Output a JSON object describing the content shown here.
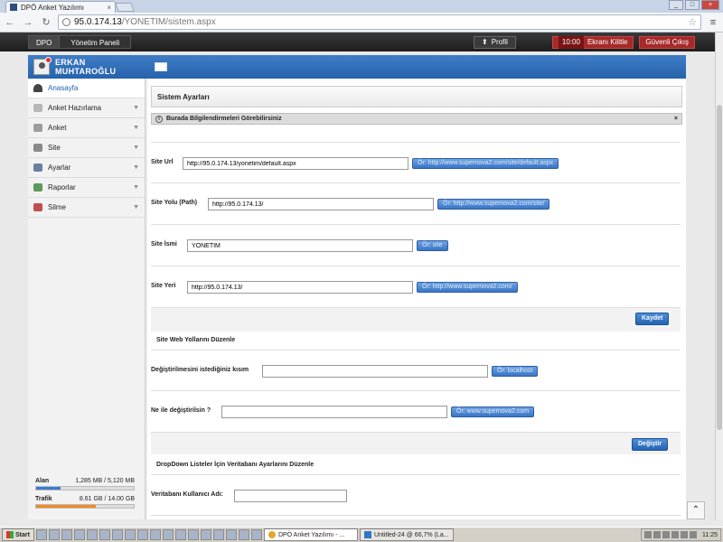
{
  "browser": {
    "tab_title": "DPÖ Anket Yazılımı",
    "url_host": "95.0.174.13",
    "url_path": "/YONETIM/sistem.aspx"
  },
  "appbar": {
    "crumb_root": "DPO",
    "crumb_current": "Yönetim Paneli",
    "profile_label": "Profil",
    "lock_time": "10:00",
    "lock_label": "Ekranı Kilitle",
    "logout_label": "Güvenli Çıkış"
  },
  "user": {
    "name": "ERKAN MUHTAROĞLU"
  },
  "sidebar": {
    "items": [
      {
        "label": "Anasayfa"
      },
      {
        "label": "Anket Hazırlama"
      },
      {
        "label": "Anket"
      },
      {
        "label": "Site"
      },
      {
        "label": "Ayarlar"
      },
      {
        "label": "Raporlar"
      },
      {
        "label": "Silme"
      }
    ],
    "alan_label": "Alan",
    "alan_value": "1,285 MB / 5,120 MB",
    "alan_fraction": 0.25,
    "trafik_label": "Trafik",
    "trafik_value": "8.61 GB / 14.00 GB",
    "trafik_fraction": 0.615
  },
  "main": {
    "panel_title": "Sistem Ayarları",
    "info_text": "Burada Bilgilendirmeleri Görebilirsiniz",
    "info_close": "×",
    "site_url_label": "Site Url",
    "site_url_value": "http://95.0.174.13/yonetim/default.aspx",
    "site_url_btn": "Ör: http://www.supernova2.com/site/default.aspx",
    "site_path_label": "Site Yolu (Path)",
    "site_path_value": "http://95.0.174.13/",
    "site_path_btn": "Ör: http://www.supernova2.com/site/",
    "site_name_label": "Site İsmi",
    "site_name_value": "YONETIM",
    "site_name_btn": "Ör: site",
    "site_loc_label": "Site Yeri",
    "site_loc_value": "http://95.0.174.13/",
    "site_loc_btn": "Ör: http://www.supernova2.com/",
    "save_label": "Kaydet",
    "web_section_title": "Site Web Yollarını Düzenle",
    "change_part_label": "Değiştirilmesini istediğiniz kısım",
    "change_part_value": "",
    "change_part_btn": "Ör: localhost",
    "replace_with_label": "Ne ile değiştirilsin ?",
    "replace_with_value": "",
    "replace_with_btn": "Ör: www.supernova2.com",
    "change_label": "Değiştir",
    "dropdown_section_title": "DropDown Listeler İçin Veritabanı Ayarlarını Düzenle",
    "db_user_label": "Veritabanı Kullanıcı Adı:",
    "db_user_value": ""
  },
  "taskbar": {
    "start_label": "Start",
    "task1": "DPÖ Anket Yazılımı - ...",
    "task2": "Untitled-24 @ 66,7% (La...",
    "clock": "11:25"
  }
}
